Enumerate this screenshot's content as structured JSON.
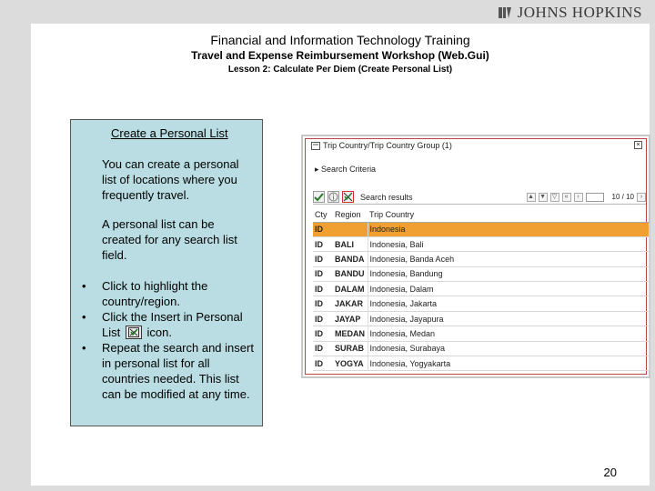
{
  "logo": {
    "text": "JOHNS HOPKINS"
  },
  "header": {
    "line1": "Financial and Information Technology Training",
    "line2": "Travel and Expense Reimbursement Workshop (Web.Gui)",
    "line3": "Lesson 2: Calculate Per Diem (Create Personal List)"
  },
  "info": {
    "title": "Create a Personal List",
    "para1": "You can create a personal list of locations where you frequently travel.",
    "para2": "A personal list can be created for any search list field.",
    "bullet1": "Click to highlight the country/region.",
    "bullet2_pre": "Click the Insert in Personal List",
    "bullet2_post": "icon.",
    "bullet3": "Repeat the search and insert in personal list for all countries needed. This list can be modified at any time.",
    "bullet_glyph": "•"
  },
  "sap": {
    "title": "Trip Country/Trip Country Group (1)",
    "close_glyph": "×",
    "criteria": "Search Criteria",
    "toolbar_label": "Search results",
    "pages": "10 / 10",
    "columns": [
      "Cty",
      "Region",
      "Trip Country"
    ],
    "rows": [
      [
        "ID",
        "",
        "Indonesia"
      ],
      [
        "ID",
        "BALI",
        "Indonesia, Bali"
      ],
      [
        "ID",
        "BANDA",
        "Indonesia, Banda Aceh"
      ],
      [
        "ID",
        "BANDU",
        "Indonesia, Bandung"
      ],
      [
        "ID",
        "DALAM",
        "Indonesia, Dalam"
      ],
      [
        "ID",
        "JAKAR",
        "Indonesia, Jakarta"
      ],
      [
        "ID",
        "JAYAP",
        "Indonesia, Jayapura"
      ],
      [
        "ID",
        "MEDAN",
        "Indonesia, Medan"
      ],
      [
        "ID",
        "SURAB",
        "Indonesia, Surabaya"
      ],
      [
        "ID",
        "YOGYA",
        "Indonesia, Yogyakarta"
      ]
    ]
  },
  "page_number": "20",
  "colors": {
    "highlight": "#f0a030",
    "info_bg": "#b9dde2",
    "frame": "#dcdcdc"
  }
}
